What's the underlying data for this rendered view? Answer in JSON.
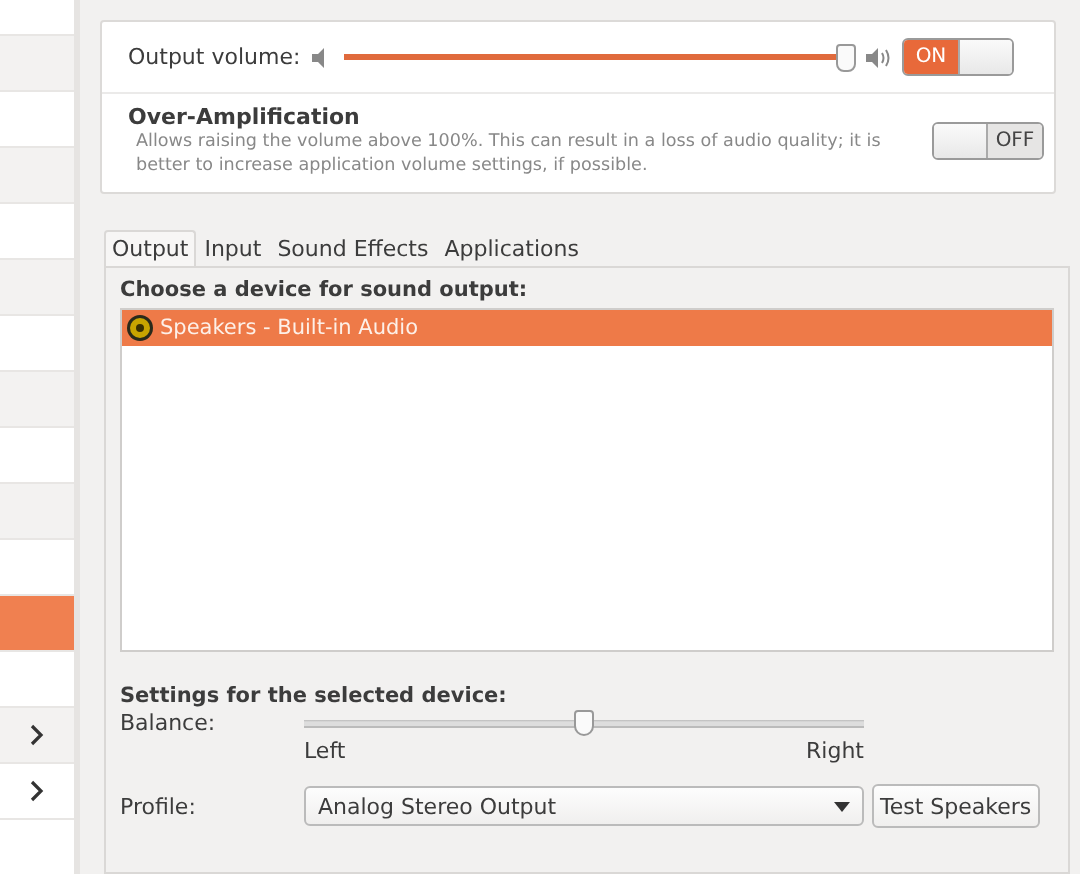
{
  "sidebar": {
    "items": [
      {
        "selected": false,
        "kind": "plain"
      },
      {
        "selected": false,
        "kind": "plain"
      },
      {
        "selected": false,
        "kind": "plain"
      },
      {
        "selected": false,
        "kind": "plain"
      },
      {
        "selected": false,
        "kind": "plain"
      },
      {
        "selected": false,
        "kind": "plain"
      },
      {
        "selected": false,
        "kind": "plain"
      },
      {
        "selected": false,
        "kind": "plain"
      },
      {
        "selected": false,
        "kind": "plain"
      },
      {
        "selected": false,
        "kind": "plain"
      },
      {
        "selected": false,
        "kind": "plain"
      },
      {
        "selected": true,
        "kind": "plain"
      },
      {
        "selected": false,
        "kind": "plain"
      },
      {
        "selected": false,
        "kind": "chevron"
      },
      {
        "selected": false,
        "kind": "chevron"
      }
    ]
  },
  "output_volume": {
    "label": "Output volume:",
    "level": 0.99,
    "switch": {
      "on": true,
      "label": "ON"
    }
  },
  "over_amplification": {
    "title": "Over-Amplification",
    "description": "Allows raising the volume above 100%. This can result in a loss of audio quality; it is better to increase application volume settings, if possible.",
    "switch": {
      "on": false,
      "label": "OFF"
    }
  },
  "tabs": [
    {
      "label": "Output",
      "selected": true
    },
    {
      "label": "Input",
      "selected": false
    },
    {
      "label": "Sound Effects",
      "selected": false
    },
    {
      "label": "Applications",
      "selected": false
    }
  ],
  "device_heading": "Choose a device for sound output:",
  "devices": [
    {
      "name": "Speakers - Built-in Audio",
      "selected": true
    }
  ],
  "settings_heading": "Settings for the selected device:",
  "balance": {
    "label": "Balance:",
    "level": 0.5,
    "left": "Left",
    "right": "Right"
  },
  "profile": {
    "label": "Profile:",
    "value": "Analog Stereo Output"
  },
  "test_button": "Test Speakers"
}
